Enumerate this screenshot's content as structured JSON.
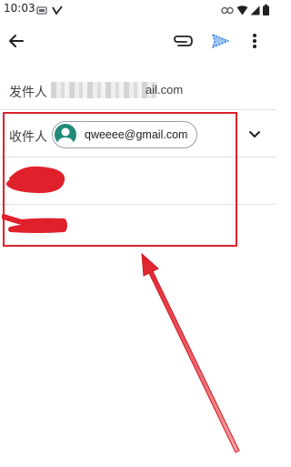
{
  "status": {
    "time": "10:03",
    "icons": [
      "sim-icon",
      "check-icon",
      "link-icon",
      "wifi-icon",
      "signal-icon",
      "battery-icon"
    ]
  },
  "toolbar": {
    "back_icon": "back-arrow-icon",
    "attach_icon": "paperclip-icon",
    "send_icon": "send-icon",
    "more_icon": "more-vert-icon"
  },
  "compose": {
    "from_label": "发件人",
    "from_value_suffix": "ail.com",
    "to_label": "收件人",
    "recipient_chip": "qweeee@gmail.com",
    "expand_icon": "chevron-down-icon"
  },
  "colors": {
    "annotation_red": "#e0212b",
    "avatar_teal": "#1f8a7a",
    "send_blue": "#1a73e8"
  }
}
